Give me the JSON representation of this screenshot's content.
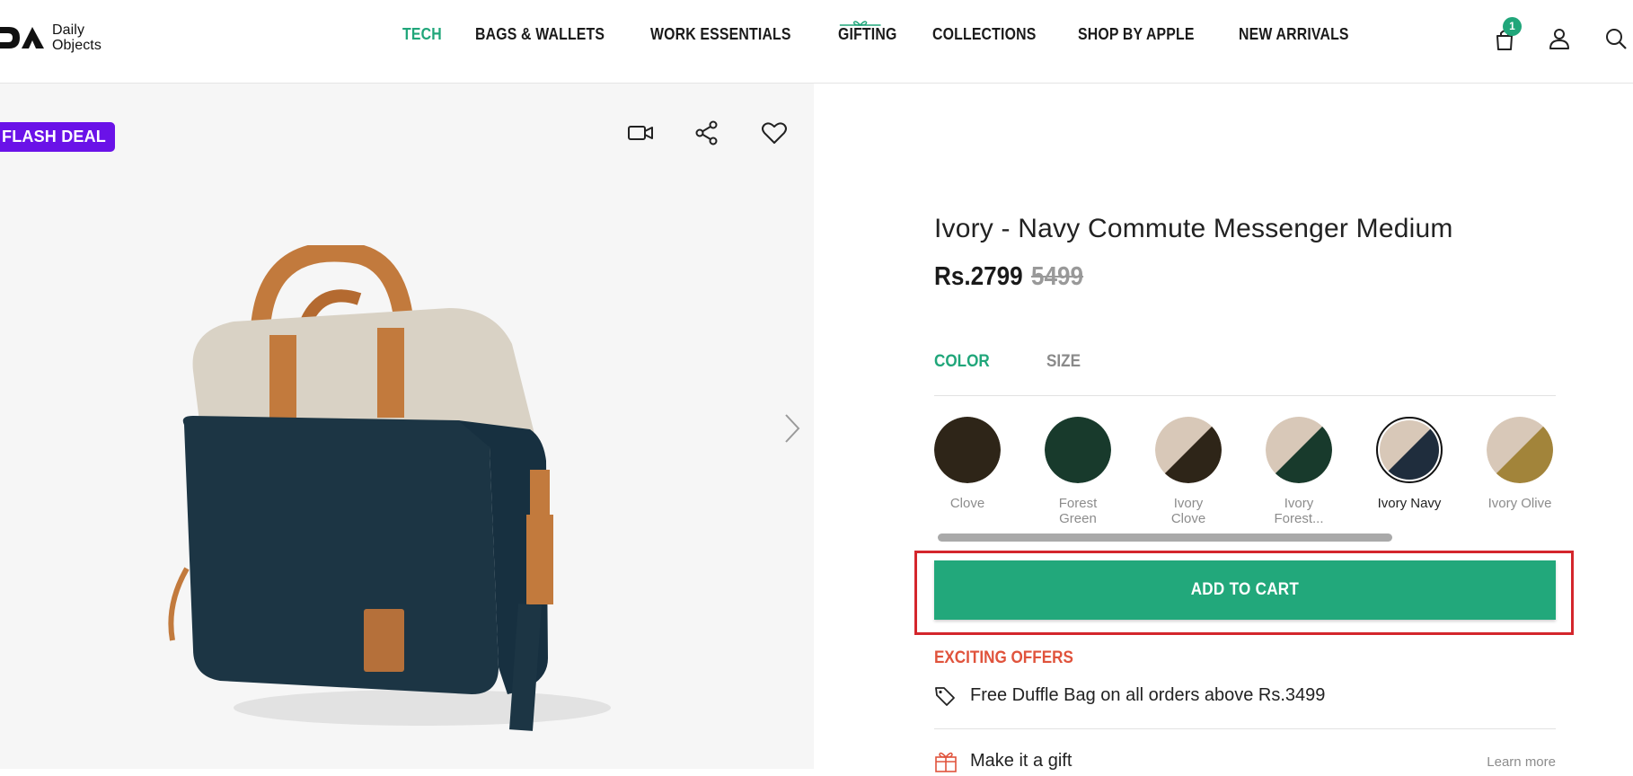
{
  "brand": {
    "logo_line1": "Daily",
    "logo_line2": "Objects"
  },
  "nav": {
    "items": [
      {
        "label": "TECH",
        "active": true
      },
      {
        "label": "BAGS & WALLETS"
      },
      {
        "label": "WORK ESSENTIALS"
      },
      {
        "label": "GIFTING"
      },
      {
        "label": "COLLECTIONS"
      },
      {
        "label": "SHOP BY APPLE"
      },
      {
        "label": "NEW ARRIVALS"
      }
    ]
  },
  "header": {
    "cart_count": "1",
    "icons": [
      "cart-icon",
      "account-icon",
      "search-icon"
    ]
  },
  "gallery": {
    "badge": "FLASH DEAL",
    "actions": [
      "video-icon",
      "share-icon",
      "wishlist-heart-icon"
    ]
  },
  "product": {
    "title": "Ivory - Navy Commute Messenger Medium",
    "price": "Rs.2799",
    "mrp": "5499"
  },
  "tabs": {
    "color": "COLOR",
    "size": "SIZE"
  },
  "swatches": [
    {
      "label": "Clove",
      "c1": "#2e2518",
      "c2": "#2e2518"
    },
    {
      "label": "Forest Green",
      "c1": "#183a2c",
      "c2": "#183a2c"
    },
    {
      "label": "Ivory Clove",
      "c1": "#d8c8b8",
      "c2": "#2e2518"
    },
    {
      "label": "Ivory Forest...",
      "c1": "#d8c8b8",
      "c2": "#183a2c"
    },
    {
      "label": "Ivory Navy",
      "c1": "#d8c8b8",
      "c2": "#1f2d3d",
      "selected": true
    },
    {
      "label": "Ivory Olive",
      "c1": "#d8c8b8",
      "c2": "#a2843a"
    }
  ],
  "cta": {
    "add_to_cart": "ADD TO CART"
  },
  "offers": {
    "heading": "EXCITING OFFERS",
    "items": [
      {
        "text": "Free Duffle Bag on all orders above Rs.3499"
      }
    ]
  },
  "gift": {
    "label": "Make it a gift",
    "link": "Learn more"
  },
  "colors": {
    "accent": "#20a67a",
    "flash": "#6a12e8",
    "offer": "#e0533c",
    "highlight": "#d4262c"
  }
}
